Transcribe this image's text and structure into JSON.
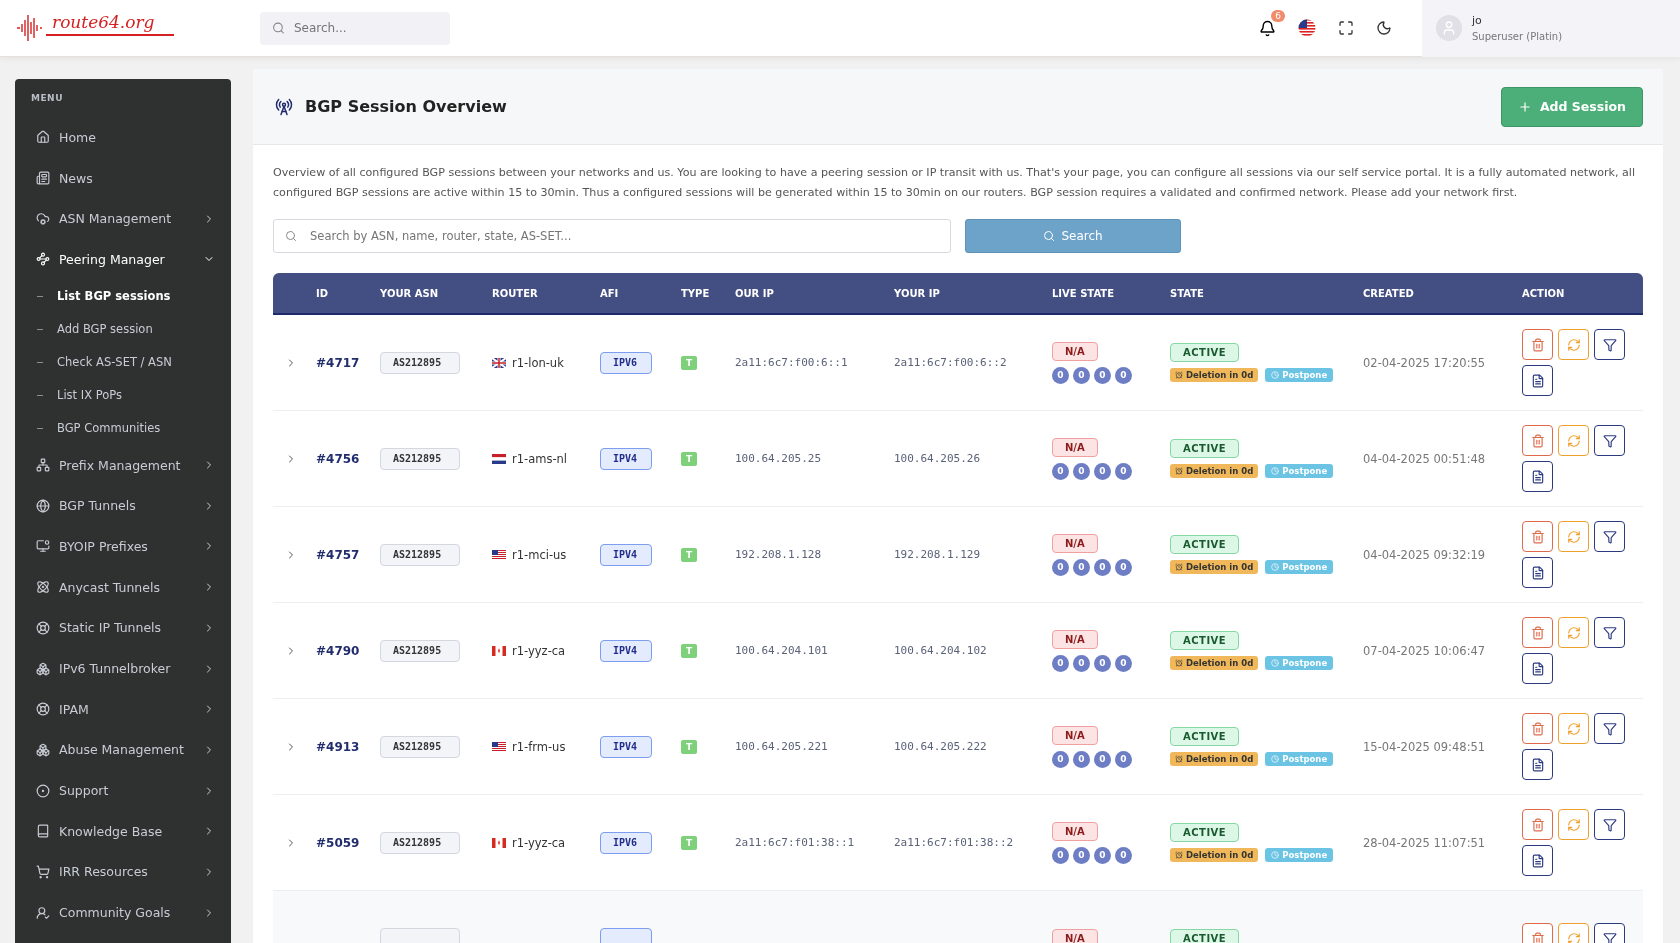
{
  "header": {
    "logo": "route64.org",
    "search": {
      "placeholder": "Search..."
    },
    "notifications": "6",
    "user": {
      "name": "jo",
      "role": "Superuser (Platin)"
    }
  },
  "sidebar": {
    "title": "MENU",
    "items": [
      {
        "label": "Home"
      },
      {
        "label": "News"
      },
      {
        "label": "ASN Management",
        "expanded": false
      },
      {
        "label": "Peering Manager",
        "expanded": true,
        "children": [
          {
            "label": "List BGP sessions",
            "selected": true
          },
          {
            "label": "Add BGP session",
            "selected": false
          },
          {
            "label": "Check AS-SET / ASN",
            "selected": false
          },
          {
            "label": "List IX PoPs",
            "selected": false
          },
          {
            "label": "BGP Communities",
            "selected": false
          }
        ]
      },
      {
        "label": "Prefix Management",
        "expanded": false
      },
      {
        "label": "BGP Tunnels",
        "expanded": false
      },
      {
        "label": "BYOIP Prefixes",
        "expanded": false
      },
      {
        "label": "Anycast Tunnels",
        "expanded": false
      },
      {
        "label": "Static IP Tunnels",
        "expanded": false
      },
      {
        "label": "IPv6 Tunnelbroker",
        "expanded": false
      },
      {
        "label": "IPAM",
        "expanded": false
      },
      {
        "label": "Abuse Management",
        "expanded": false
      },
      {
        "label": "Support",
        "expanded": false
      },
      {
        "label": "Knowledge Base",
        "expanded": false
      },
      {
        "label": "IRR Resources",
        "expanded": false
      },
      {
        "label": "Community Goals",
        "expanded": false
      }
    ]
  },
  "page": {
    "title": "BGP Session Overview",
    "add_button": "Add Session",
    "description": "Overview of all configured BGP sessions between your networks and us. You are looking to have a peering session or IP transit with us. That's your page, you can configure all sessions via our self service portal. It is a fully automated network, all configured BGP sessions are active within 15 to 30min. Thus a configured sessions will be generated within 15 to 30min on our routers. BGP session requires a validated and confirmed network. Please add your network first.",
    "search": {
      "placeholder": "Search by ASN, name, router, state, AS-SET...",
      "button": "Search"
    }
  },
  "table": {
    "columns": [
      "ID",
      "YOUR ASN",
      "ROUTER",
      "AFI",
      "TYPE",
      "OUR IP",
      "YOUR IP",
      "LIVE STATE",
      "STATE",
      "CREATED",
      "ACTION"
    ],
    "rows": [
      {
        "kind": "full",
        "id": "#4717",
        "asn": "AS212895",
        "router": "r1-lon-uk",
        "afi": "IPV6",
        "type": "T",
        "our_ip": "2a11:6c7:f00:6::1",
        "your_ip": "2a11:6c7:f00:6::2",
        "live_state": "N/A",
        "counters": [
          "0",
          "0",
          "0",
          "0"
        ],
        "state": "ACTIVE",
        "deletion": "Deletion in 0d",
        "postpone": "Postpone",
        "created": "02-04-2025 17:20:55"
      },
      {
        "kind": "full",
        "id": "#4756",
        "asn": "AS212895",
        "router": "r1-ams-nl",
        "afi": "IPV4",
        "type": "T",
        "our_ip": "100.64.205.25",
        "your_ip": "100.64.205.26",
        "live_state": "N/A",
        "counters": [
          "0",
          "0",
          "0",
          "0"
        ],
        "state": "ACTIVE",
        "deletion": "Deletion in 0d",
        "postpone": "Postpone",
        "created": "04-04-2025 00:51:48"
      },
      {
        "kind": "full",
        "id": "#4757",
        "asn": "AS212895",
        "router": "r1-mci-us",
        "afi": "IPV4",
        "type": "T",
        "our_ip": "192.208.1.128",
        "your_ip": "192.208.1.129",
        "live_state": "N/A",
        "counters": [
          "0",
          "0",
          "0",
          "0"
        ],
        "state": "ACTIVE",
        "deletion": "Deletion in 0d",
        "postpone": "Postpone",
        "created": "04-04-2025 09:32:19"
      },
      {
        "kind": "full",
        "id": "#4790",
        "asn": "AS212895",
        "router": "r1-yyz-ca",
        "afi": "IPV4",
        "type": "T",
        "our_ip": "100.64.204.101",
        "your_ip": "100.64.204.102",
        "live_state": "N/A",
        "counters": [
          "0",
          "0",
          "0",
          "0"
        ],
        "state": "ACTIVE",
        "deletion": "Deletion in 0d",
        "postpone": "Postpone",
        "created": "07-04-2025 10:06:47"
      },
      {
        "kind": "full",
        "id": "#4913",
        "asn": "AS212895",
        "router": "r1-frm-us",
        "afi": "IPV4",
        "type": "T",
        "our_ip": "100.64.205.221",
        "your_ip": "100.64.205.222",
        "live_state": "N/A",
        "counters": [
          "0",
          "0",
          "0",
          "0"
        ],
        "state": "ACTIVE",
        "deletion": "Deletion in 0d",
        "postpone": "Postpone",
        "created": "15-04-2025 09:48:51"
      },
      {
        "kind": "full",
        "id": "#5059",
        "asn": "AS212895",
        "router": "r1-yyz-ca",
        "afi": "IPV6",
        "type": "T",
        "our_ip": "2a11:6c7:f01:38::1",
        "your_ip": "2a11:6c7:f01:38::2",
        "live_state": "N/A",
        "counters": [
          "0",
          "0",
          "0",
          "0"
        ],
        "state": "ACTIVE",
        "deletion": "Deletion in 0d",
        "postpone": "Postpone",
        "created": "28-04-2025 11:07:51"
      },
      {
        "kind": "partial",
        "live_state": "N/A",
        "state": "ACTIVE"
      }
    ]
  }
}
